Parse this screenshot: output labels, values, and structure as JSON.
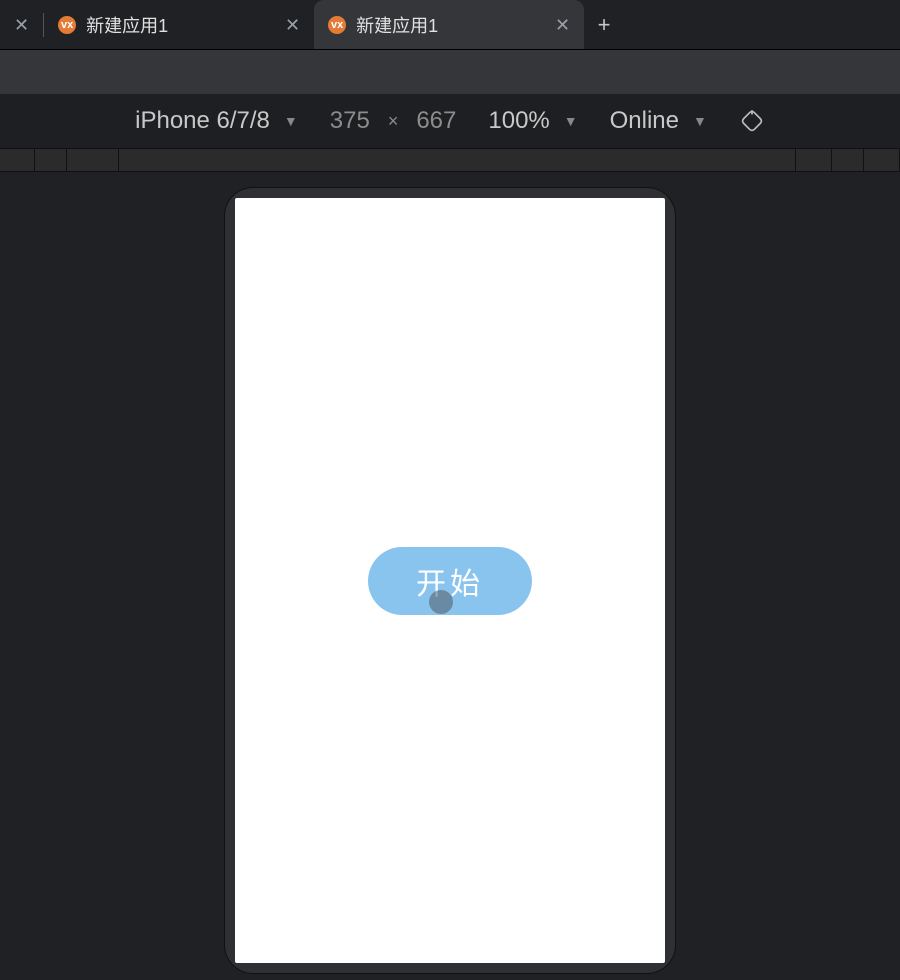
{
  "tabs": {
    "first": {
      "label": "新建应用1"
    },
    "second": {
      "label": "新建应用1"
    }
  },
  "device_toolbar": {
    "device": "iPhone 6/7/8",
    "width": "375",
    "height": "667",
    "zoom": "100%",
    "network": "Online"
  },
  "canvas": {
    "start_button": "开始"
  },
  "glyphs": {
    "close": "✕",
    "plus": "+",
    "caret": "▼",
    "vx": "vx"
  }
}
